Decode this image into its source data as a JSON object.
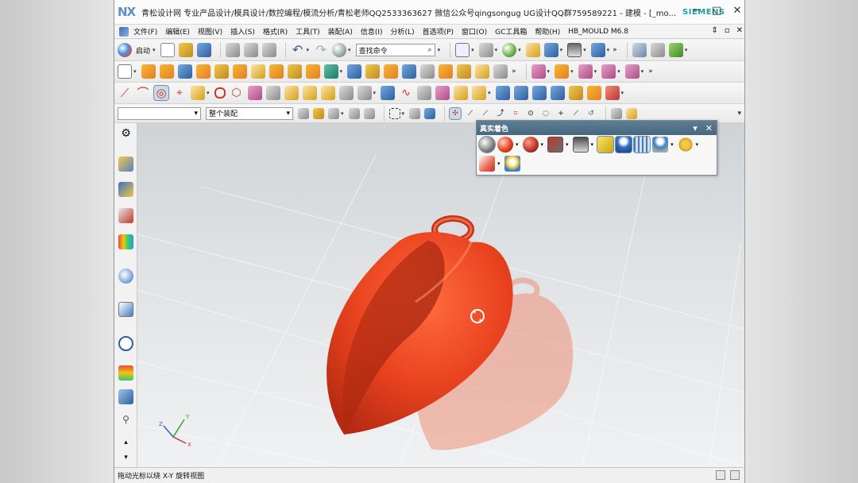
{
  "window": {
    "logo": "NX",
    "title": "青松设计网 专业产品设计/模具设计/数控编程/模流分析/青松老师QQ2533363627 微信公众号qingsongug UG设计QQ群759589221 - 建模 - [_mo...",
    "vendor": "SIEMENS",
    "controls": {
      "minimize": "─",
      "maximize": "□",
      "close": "✕"
    }
  },
  "menubar": {
    "items": [
      "文件(F)",
      "编辑(E)",
      "视图(V)",
      "插入(S)",
      "格式(R)",
      "工具(T)",
      "装配(A)",
      "信息(I)",
      "分析(L)",
      "首选项(P)",
      "窗口(O)",
      "GC工具箱",
      "帮助(H)",
      "HB_MOULD M6.8"
    ],
    "right_controls": [
      "⇕",
      "▫",
      "✕"
    ]
  },
  "toolbar_standard": {
    "start_label": "启动",
    "search_placeholder": "查找命令",
    "search_icon": "magnifier-icon"
  },
  "toolbar_selection": {
    "filter_value": "",
    "scope_value": "整个装配"
  },
  "true_shading_panel": {
    "title": "真实着色",
    "controls": {
      "pin": "▾",
      "close": "✕"
    }
  },
  "viewport": {
    "model": "heart-pendant",
    "model_color": "#e8421f",
    "triad": {
      "x": "X",
      "y": "Y",
      "z": "Z"
    }
  },
  "status": {
    "message": "拖动光标以绕 X-Y 旋转视图"
  },
  "colors": {
    "panel_header": "#4f7088",
    "model_red": "#e8421f",
    "shadow_red": "#f08f78",
    "nx_blue": "#5b8fc9",
    "siemens_teal": "#1aa0a0"
  }
}
